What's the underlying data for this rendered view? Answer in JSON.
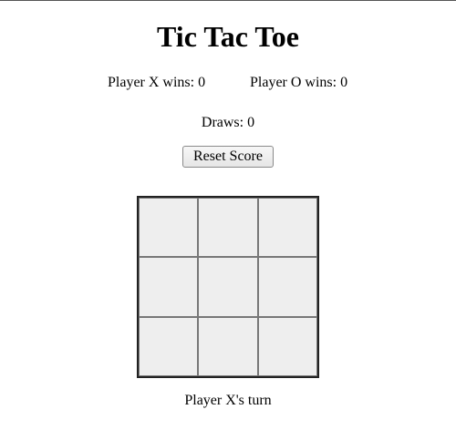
{
  "game": {
    "title": "Tic Tac Toe"
  },
  "scoreboard": {
    "x_label": "Player X wins:",
    "x_wins": "0",
    "o_label": "Player O wins:",
    "o_wins": "0",
    "draws_label": "Draws:",
    "draws": "0"
  },
  "controls": {
    "reset_label": "Reset Score"
  },
  "board": {
    "cells": [
      "",
      "",
      "",
      "",
      "",
      "",
      "",
      "",
      ""
    ]
  },
  "status": {
    "message": "Player X's turn"
  },
  "colors": {
    "cell_background": "#eeeeee",
    "grid_line": "#777777",
    "board_border": "#222222"
  }
}
